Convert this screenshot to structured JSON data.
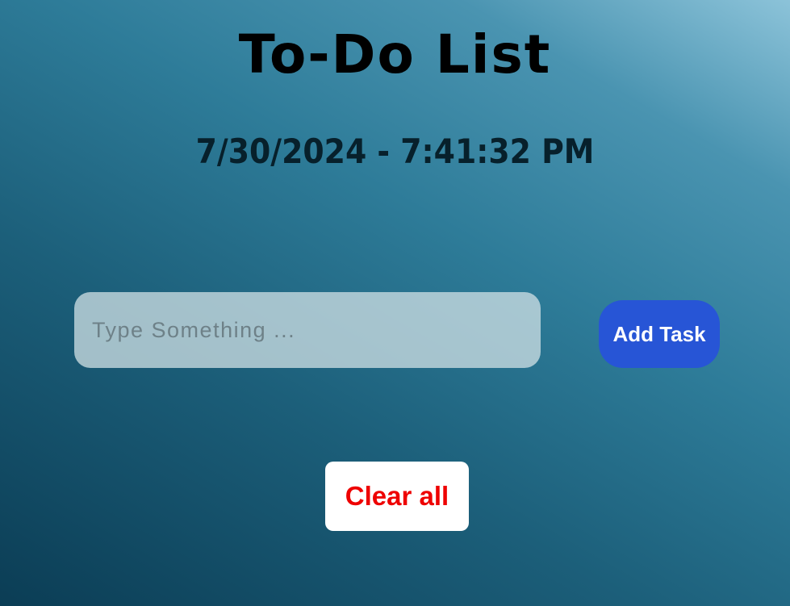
{
  "header": {
    "title": "To-Do List",
    "datetime": "7/30/2024 - 7:41:32 PM"
  },
  "task_form": {
    "input_value": "",
    "input_placeholder": "Type Something ...",
    "add_label": "Add Task"
  },
  "tasks": [],
  "footer": {
    "clear_label": "Clear all"
  },
  "colors": {
    "add_button": "#2755d6",
    "clear_text": "#ee0000",
    "clear_background": "#ffffff"
  }
}
